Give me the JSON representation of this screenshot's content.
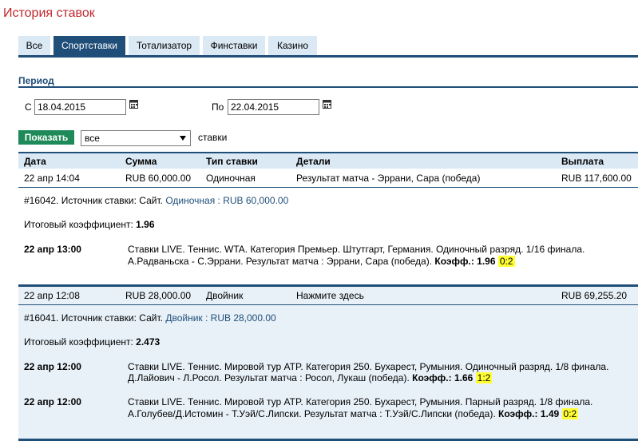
{
  "page_title": "История ставок",
  "tabs": [
    {
      "label": "Все"
    },
    {
      "label": "Спортставки"
    },
    {
      "label": "Тотализатор"
    },
    {
      "label": "Финставки"
    },
    {
      "label": "Казино"
    }
  ],
  "period": {
    "title": "Период",
    "from_label": "С",
    "from_value": "18.04.2015",
    "to_label": "По",
    "to_value": "22.04.2015"
  },
  "filter": {
    "show_button": "Показать",
    "select_value": "все",
    "select_suffix": "ставки"
  },
  "table": {
    "headers": [
      "Дата",
      "Сумма",
      "Тип ставки",
      "Детали",
      "Выплата"
    ],
    "bets": [
      {
        "date": "22 апр 14:04",
        "amount": "RUB 60,000.00",
        "type": "Одиночная",
        "details": "Результат матча - Эррани, Сара (победа)",
        "payout": "RUB 117,600.00",
        "source_prefix": "#16042. Источник ставки: Сайт.",
        "source_link": "Одиночная : RUB 60,000.00",
        "total_coef_label": "Итоговый коэффициент:",
        "total_coef": "1.96",
        "events": [
          {
            "time": "22 апр 13:00",
            "line1": "Ставки LIVE. Теннис. WTA. Категория Премьер. Штутгарт, Германия. Одиночный разряд. 1/16 финала.",
            "line2": "А.Радваньска - С.Эррани. Результат матча : Эррани, Сара (победа).",
            "coef_label": "Коэфф.:",
            "coef": "1.96",
            "score": "0:2"
          }
        ]
      },
      {
        "date": "22 апр 12:08",
        "amount": "RUB 28,000.00",
        "type": "Двойник",
        "details": "Нажмите здесь",
        "payout": "RUB 69,255.20",
        "source_prefix": "#16041. Источник ставки: Сайт.",
        "source_link": "Двойник : RUB 28,000.00",
        "total_coef_label": "Итоговый коэффициент:",
        "total_coef": "2.473",
        "events": [
          {
            "time": "22 апр 12:00",
            "line1": "Ставки LIVE. Теннис. Мировой тур ATP. Категория 250. Бухарест, Румыния. Одиночный разряд. 1/8 финала.",
            "line2": "Д.Лайович - Л.Росол. Результат матча : Росол, Лукаш (победа).",
            "coef_label": "Коэфф.:",
            "coef": "1.66",
            "score": "1:2"
          },
          {
            "time": "22 апр 12:00",
            "line1": "Ставки LIVE. Теннис. Мировой тур ATP. Категория 250. Бухарест, Румыния. Парный разряд. 1/8 финала.",
            "line2": "А.Голубев/Д.Истомин - Т.Уэй/С.Липски. Результат матча : Т.Уэй/С.Липски (победа).",
            "coef_label": "Коэфф.:",
            "coef": "1.49",
            "score": "0:2"
          }
        ]
      }
    ]
  },
  "colors": {
    "title_red": "#c0272d",
    "navy": "#1f4e79",
    "light_blue": "#dbe9f4",
    "green_button": "#1e8a5a",
    "highlight": "#ffff33"
  }
}
